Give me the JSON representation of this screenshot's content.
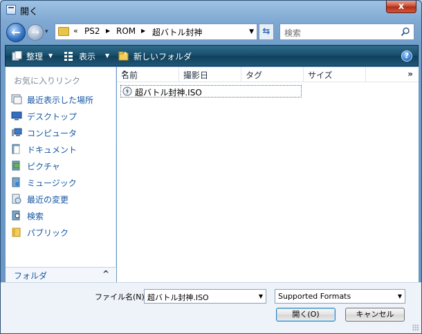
{
  "window": {
    "title": "開く",
    "close_label": "x"
  },
  "nav": {
    "back_glyph": "←",
    "forward_glyph": "→",
    "dropdown_glyph": "▾",
    "refresh_glyph": "⇆",
    "address": {
      "overflow": "«",
      "segments": [
        "PS2",
        "ROM",
        "超バトル封神"
      ]
    },
    "search_placeholder": "検索"
  },
  "toolbar": {
    "organize": "整理",
    "views": "表示",
    "new_folder": "新しいフォルダ",
    "help": "?"
  },
  "sidebar": {
    "favorites_title": "お気に入りリンク",
    "items": [
      {
        "label": "最近表示した場所",
        "icon": "recent-places-icon"
      },
      {
        "label": "デスクトップ",
        "icon": "desktop-icon"
      },
      {
        "label": "コンピュータ",
        "icon": "computer-icon"
      },
      {
        "label": "ドキュメント",
        "icon": "documents-icon"
      },
      {
        "label": "ピクチャ",
        "icon": "pictures-icon"
      },
      {
        "label": "ミュージック",
        "icon": "music-icon"
      },
      {
        "label": "最近の変更",
        "icon": "recently-changed-icon"
      },
      {
        "label": "検索",
        "icon": "searches-icon"
      },
      {
        "label": "パブリック",
        "icon": "public-folder-icon"
      }
    ],
    "folders_label": "フォルダ",
    "folders_chevron": "^"
  },
  "file_list": {
    "columns": [
      "名前",
      "撮影日",
      "タグ",
      "サイズ"
    ],
    "more": "»",
    "sort_indicator": "^",
    "files": [
      {
        "name": "超バトル封神.ISO",
        "icon": "disc-image-icon"
      }
    ]
  },
  "bottom": {
    "filename_label": "ファイル名(N):",
    "filename_value": "超バトル封神.ISO",
    "filetype_value": "Supported Formats",
    "open_button": "開く(O)",
    "cancel_button": "キャンセル"
  },
  "colors": {
    "toolbar_bg": "#174d6b",
    "link_blue": "#1655a2",
    "close_red": "#c6432b"
  }
}
